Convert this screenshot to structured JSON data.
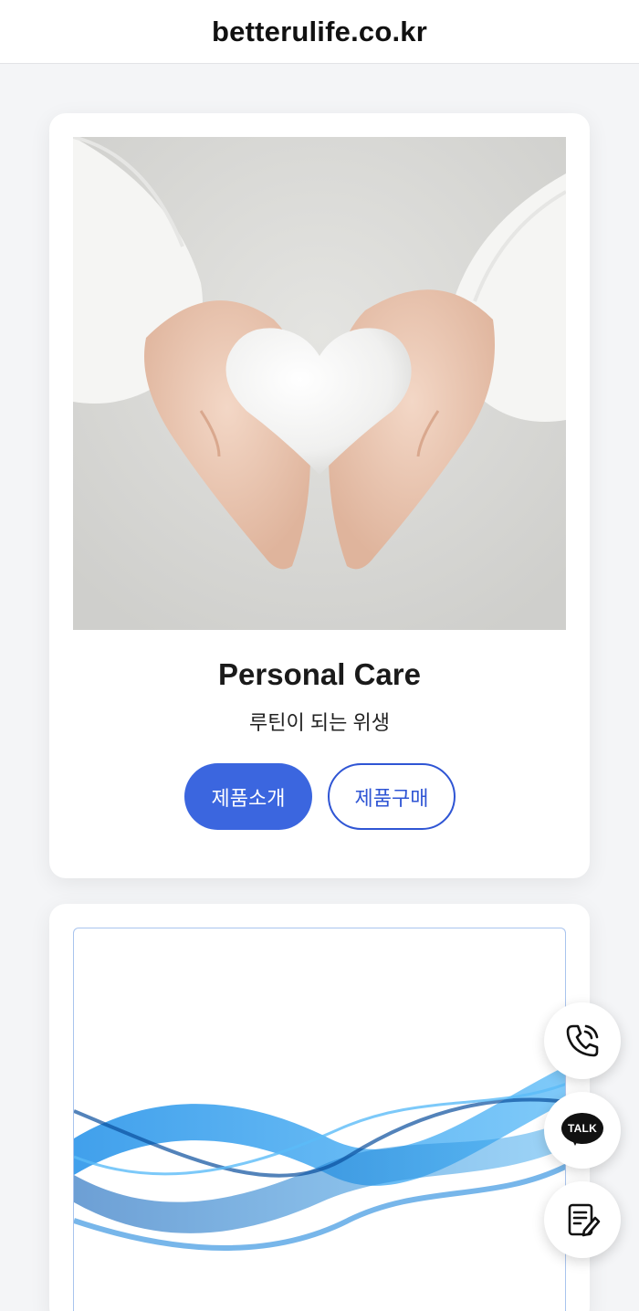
{
  "browser": {
    "domain": "betterulife.co.kr"
  },
  "cards": [
    {
      "image_alt": "hands holding white heart",
      "title": "Personal Care",
      "subtitle": "루틴이 되는 위생",
      "buttons": {
        "intro": "제품소개",
        "buy": "제품구매"
      }
    },
    {
      "image_alt": "blue wave graphic"
    }
  ],
  "floating": {
    "call_icon": "phone-call-icon",
    "talk_label": "TALK",
    "memo_icon": "memo-edit-icon"
  },
  "colors": {
    "primary": "#3b66df",
    "outline": "#2f55d4",
    "background": "#f4f5f7"
  }
}
